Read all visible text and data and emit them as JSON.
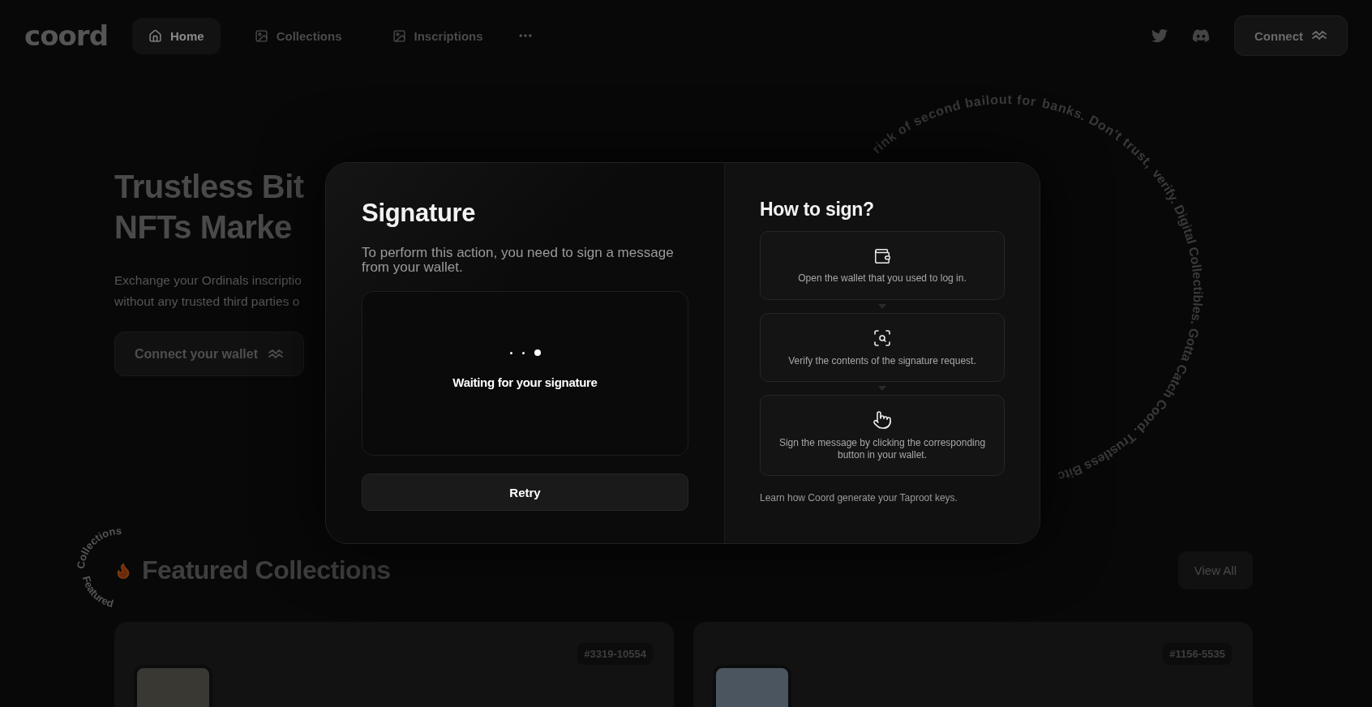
{
  "header": {
    "logo": "coord",
    "nav": [
      {
        "label": "Home",
        "kind": "home",
        "selected": true
      },
      {
        "label": "Collections",
        "kind": "image",
        "selected": false
      },
      {
        "label": "Inscriptions",
        "kind": "image",
        "selected": false
      }
    ],
    "connect": "Connect"
  },
  "hero": {
    "title": [
      "Trustless Bit",
      "NFTs Marke"
    ],
    "subtitle": [
      "Exchange your Ordinals inscriptio",
      "without any trusted third parties o"
    ],
    "connect_wallet": "Connect your wallet"
  },
  "ring_text": [
    "rink of second bailout for ",
    "banks. Don't trust, ",
    "verify. Digital Collectibles. Gotta Catch Coord. Trustless Bitc"
  ],
  "featured": {
    "ring": [
      "Collections",
      "Featured"
    ],
    "title": "Featured Collections",
    "view_all": "View All",
    "cards": [
      {
        "id": "#3319-10554",
        "kind": "sepia"
      },
      {
        "id": "#1156-5535",
        "kind": "pixel"
      }
    ]
  },
  "dialog": {
    "title": "Signature",
    "description": "To perform this action, you need to sign a message from your wallet.",
    "loader_dots": [
      {
        "active": false
      },
      {
        "active": false
      },
      {
        "active": true
      }
    ],
    "status": "Waiting for your signature",
    "retry": "Retry",
    "help": {
      "title": "How to sign?",
      "steps": [
        {
          "kind": "wallet",
          "text": "Open the wallet that you used to log in."
        },
        {
          "kind": "scan",
          "text": "Verify the contents of the signature request."
        },
        {
          "kind": "tap",
          "text": "Sign the message by clicking the corresponding button in your wallet."
        }
      ],
      "footer": "Learn how Coord generate your Taproot keys."
    }
  }
}
